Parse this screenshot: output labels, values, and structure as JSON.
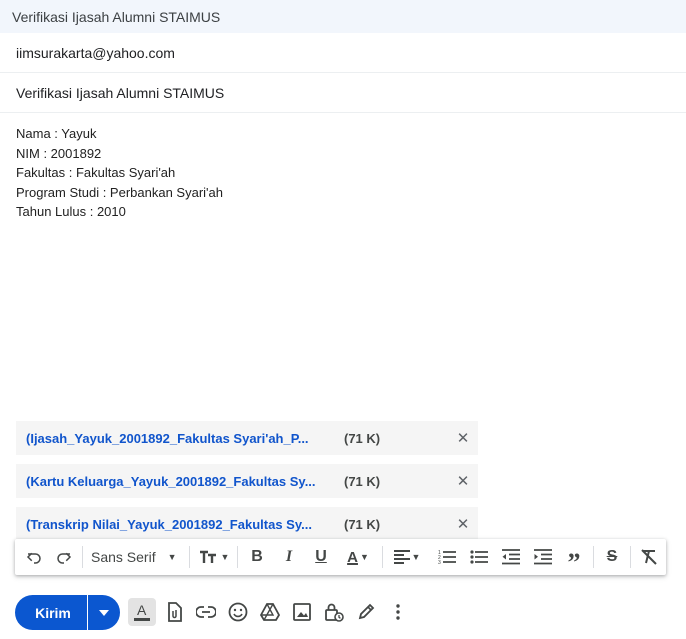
{
  "window": {
    "title": "Verifikasi Ijasah Alumni STAIMUS"
  },
  "compose": {
    "to": "iimsurakarta@yahoo.com",
    "subject": "Verifikasi Ijasah Alumni STAIMUS",
    "body_lines": [
      "Nama : Yayuk",
      "NIM : 2001892",
      "Fakultas : Fakultas Syari'ah",
      "Program Studi : Perbankan Syari'ah",
      "Tahun Lulus : 2010"
    ]
  },
  "attachments": [
    {
      "name": "(Ijasah_Yayuk_2001892_Fakultas Syari'ah_P...",
      "size": "(71 K)"
    },
    {
      "name": "(Kartu Keluarga_Yayuk_2001892_Fakultas Sy...",
      "size": "(71 K)"
    },
    {
      "name": "(Transkrip Nilai_Yayuk_2001892_Fakultas Sy...",
      "size": "(71 K)"
    }
  ],
  "format_toolbar": {
    "font": "Sans Serif",
    "icons": [
      "undo-icon",
      "redo-icon",
      "font-size-icon",
      "bold-icon",
      "italic-icon",
      "underline-icon",
      "text-color-icon",
      "align-icon",
      "numbered-list-icon",
      "bulleted-list-icon",
      "indent-less-icon",
      "indent-more-icon",
      "quote-icon",
      "strikethrough-icon",
      "clear-formatting-icon"
    ]
  },
  "bottom_bar": {
    "send_label": "Kirim",
    "icons": [
      "formatting-options-icon",
      "attach-file-icon",
      "insert-link-icon",
      "emoji-icon",
      "drive-icon",
      "insert-photo-icon",
      "confidential-mode-icon",
      "signature-icon",
      "more-options-icon"
    ]
  },
  "colors": {
    "accent": "#0b57d0",
    "link": "#1155cc",
    "titlebar_bg": "#f2f6fc",
    "attachment_bg": "#f5f5f5"
  }
}
